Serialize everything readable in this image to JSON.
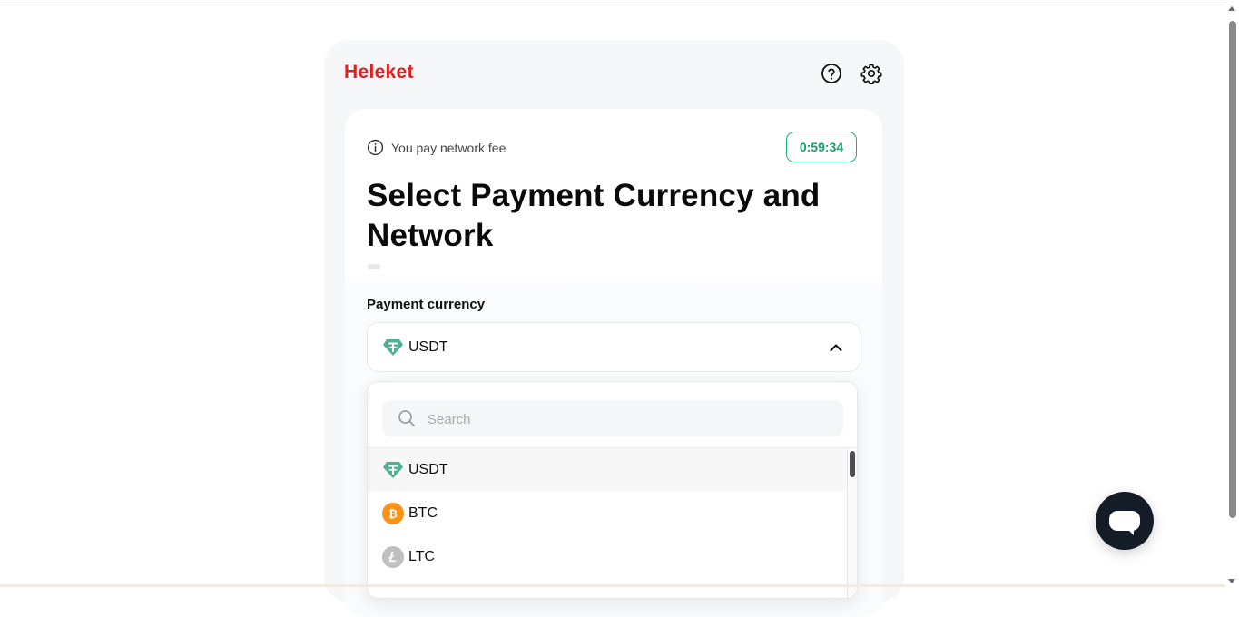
{
  "brand": {
    "name": "Heleket",
    "color": "#e0201f"
  },
  "header": {
    "help_icon": "question-circle-icon",
    "settings_icon": "gear-icon"
  },
  "notice": {
    "icon": "info-circle-icon",
    "text": "You pay network fee"
  },
  "timer": {
    "value": "0:59:34",
    "color": "#1a9d67"
  },
  "title": "Select Payment Currency and Network",
  "payment_currency": {
    "label": "Payment currency",
    "selected": "USDT",
    "expanded": true
  },
  "dropdown": {
    "search_placeholder": "Search",
    "items": [
      {
        "label": "USDT",
        "icon": "tether-icon",
        "color": "#50af95",
        "selected": true
      },
      {
        "label": "BTC",
        "icon": "bitcoin-icon",
        "color": "#f7931a",
        "selected": false
      },
      {
        "label": "LTC",
        "icon": "litecoin-icon",
        "color": "#bfbfbf",
        "selected": false
      }
    ]
  },
  "chat": {
    "icon": "chat-bubble-icon"
  }
}
